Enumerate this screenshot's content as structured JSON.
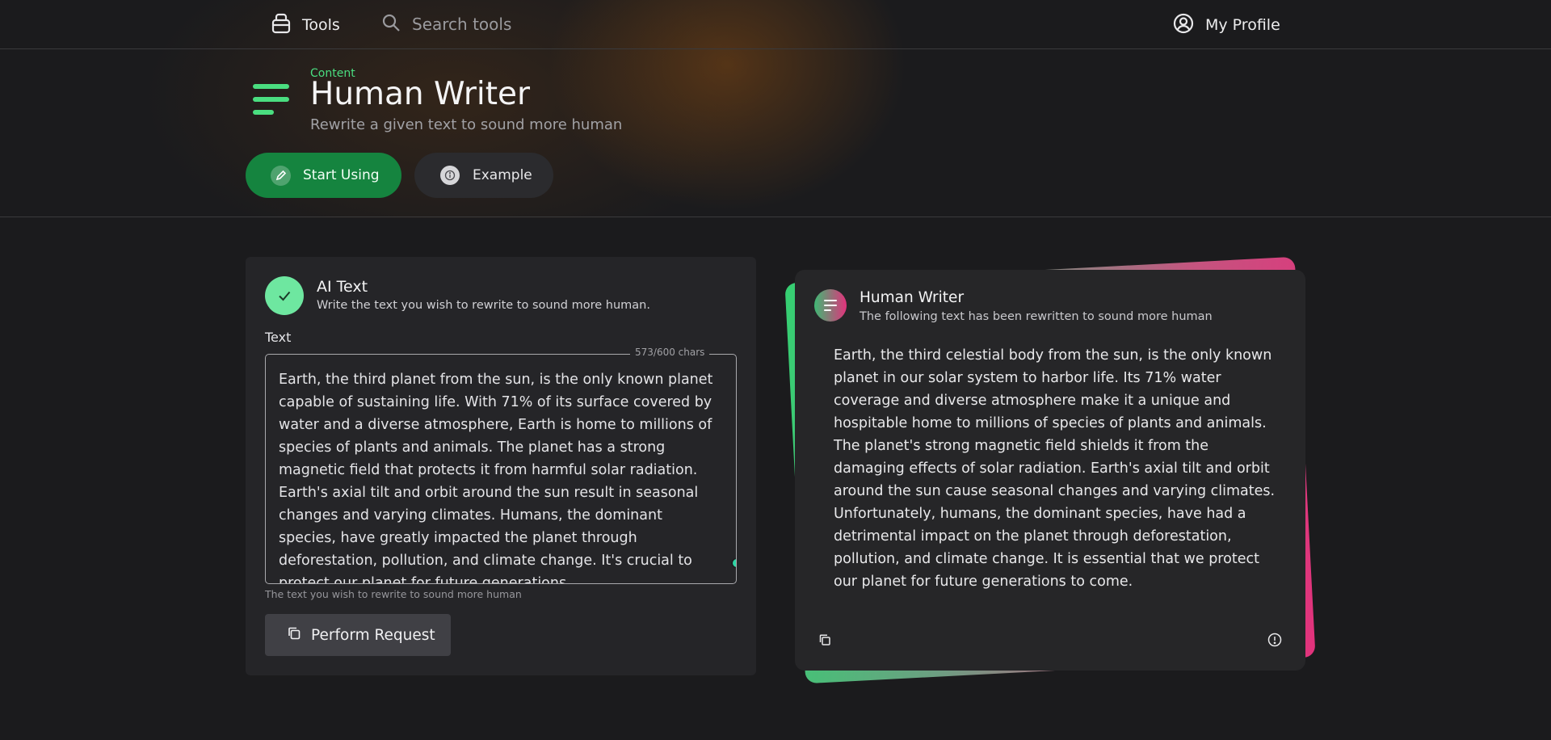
{
  "nav": {
    "tools_label": "Tools",
    "search_placeholder": "Search tools",
    "profile_label": "My Profile"
  },
  "header": {
    "category": "Content",
    "title": "Human Writer",
    "subtitle": "Rewrite a given text to sound more human",
    "start_label": "Start Using",
    "example_label": "Example"
  },
  "input_card": {
    "title": "AI Text",
    "subtitle": "Write the text you wish to rewrite to sound more human.",
    "field_label": "Text",
    "char_count": "573/600 chars",
    "text_value": "Earth, the third planet from the sun, is the only known planet capable of sustaining life. With 71% of its surface covered by water and a diverse atmosphere, Earth is home to millions of species of plants and animals. The planet has a strong magnetic field that protects it from harmful solar radiation. Earth's axial tilt and orbit around the sun result in seasonal changes and varying climates. Humans, the dominant species, have greatly impacted the planet through deforestation, pollution, and climate change. It's crucial to protect our planet for future generations.",
    "helper_text": "The text you wish to rewrite to sound more human",
    "perform_label": "Perform Request"
  },
  "output_card": {
    "title": "Human Writer",
    "subtitle": "The following text has been rewritten to sound more human",
    "output_text": "Earth, the third celestial body from the sun, is the only known planet in our solar system to harbor life. Its 71% water coverage and diverse atmosphere make it a unique and hospitable home to millions of species of plants and animals. The planet's strong magnetic field shields it from the damaging effects of solar radiation. Earth's axial tilt and orbit around the sun cause seasonal changes and varying climates. Unfortunately, humans, the dominant species, have had a detrimental impact on the planet through deforestation, pollution, and climate change. It is essential that we protect our planet for future generations to come."
  },
  "colors": {
    "accent_green": "#4ade80",
    "start_button": "#15843f",
    "gradient_pink": "#e2327c",
    "background": "#1b1b1d"
  },
  "icons": {
    "tools": "toolbox-icon",
    "search": "search-icon",
    "profile": "user-circle-icon",
    "header": "menu-lines-icon",
    "start": "pencil-icon",
    "example": "info-icon",
    "check": "check-icon",
    "perform": "copy-icon",
    "avatar": "menu-lines-icon",
    "copy": "copy-icon",
    "info": "info-icon"
  }
}
